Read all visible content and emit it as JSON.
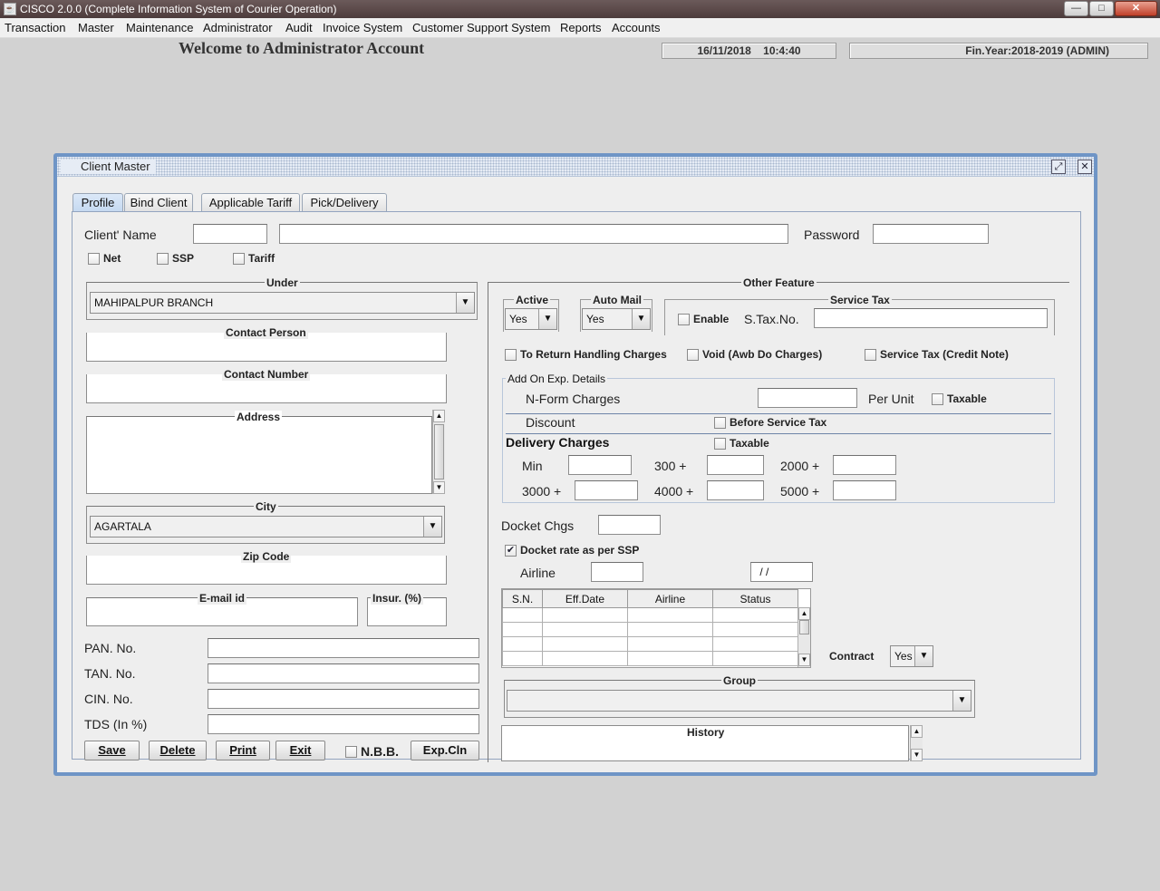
{
  "window": {
    "title": "CISCO 2.0.0 (Complete Information System of Courier Operation)",
    "icon": "java-cup-icon",
    "min": "—",
    "max": "□",
    "close": "✕"
  },
  "menu": [
    "Transaction",
    "Master",
    "Maintenance",
    "Administrator",
    "Audit",
    "Invoice System",
    "Customer Support System",
    "Reports",
    "Accounts"
  ],
  "header": {
    "welcome": "Welcome to Administrator Account",
    "datetime": "16/11/2018    10:4:40",
    "finyear": "Fin.Year:2018-2019  (ADMIN)"
  },
  "frame": {
    "title": "Client Master"
  },
  "tabs": [
    "Profile",
    "Bind Client",
    "Applicable Tariff",
    "Pick/Delivery"
  ],
  "profile": {
    "client_name_label": "Client' Name",
    "password_label": "Password",
    "net_label": "Net",
    "ssp_label": "SSP",
    "tariff_label": "Tariff",
    "under_label": "Under",
    "under_value": "MAHIPALPUR BRANCH",
    "contact_person_label": "Contact Person",
    "contact_number_label": "Contact Number",
    "address_label": "Address",
    "city_label": "City",
    "city_value": "AGARTALA",
    "zip_label": "Zip Code",
    "email_label": "E-mail id",
    "insur_label": "Insur. (%)",
    "pan_label": "PAN. No.",
    "tan_label": "TAN. No.",
    "cin_label": "CIN. No.",
    "tds_label": "TDS (In %)",
    "buttons": {
      "save": "Save",
      "delete": "Delete",
      "print": "Print",
      "exit": "Exit",
      "nbb": "N.B.B.",
      "expcln": "Exp.Cln"
    }
  },
  "other": {
    "title": "Other Feature",
    "active_label": "Active",
    "active_value": "Yes",
    "automail_label": "Auto Mail",
    "automail_value": "Yes",
    "service_tax_title": "Service Tax",
    "enable_label": "Enable",
    "stax_label": "S.Tax.No.",
    "return_handling": "To Return Handling Charges",
    "void_awb": "Void (Awb Do Charges)",
    "service_tax_credit": "Service Tax (Credit Note)",
    "addon_title": "Add On Exp. Details",
    "nform_label": "N-Form Charges",
    "per_unit": "Per Unit",
    "taxable": "Taxable",
    "discount_label": "Discount",
    "before_service_tax": "Before Service Tax",
    "delivery_label": "Delivery Charges",
    "taxable2": "Taxable",
    "slabs": {
      "min": "Min",
      "s300": "300 +",
      "s2000": "2000 +",
      "s3000": "3000 +",
      "s4000": "4000 +",
      "s5000": "5000 +"
    },
    "docket_chgs": "Docket Chgs",
    "docket_rate": "Docket rate as per SSP",
    "docket_rate_checked": "✔",
    "airline_label": "Airline",
    "date_value": " / /",
    "table_headers": [
      "S.N.",
      "Eff.Date",
      "Airline",
      "Status"
    ],
    "contract_label": "Contract",
    "contract_value": "Yes",
    "group_label": "Group",
    "history_label": "History"
  }
}
